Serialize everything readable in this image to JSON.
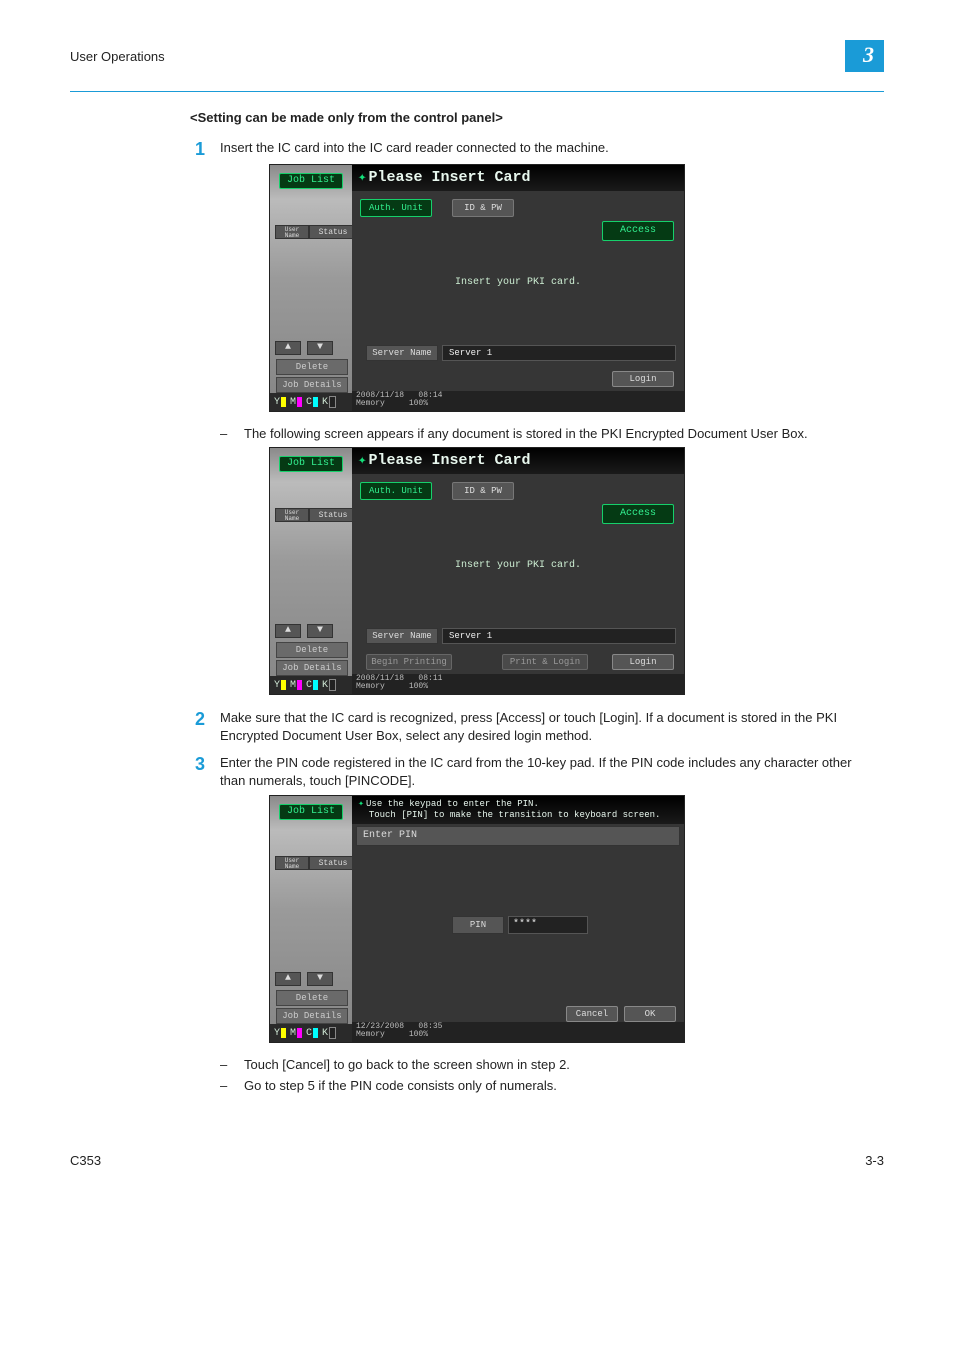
{
  "header": {
    "section": "User Operations",
    "chapter_number": "3"
  },
  "heading": "<Setting can be made only from the control panel>",
  "steps": {
    "s1": {
      "num": "1",
      "text": "Insert the IC card into the IC card reader connected to the machine."
    },
    "note1": "The following screen appears if any document is stored in the PKI Encrypted Document User Box.",
    "s2": {
      "num": "2",
      "text": "Make sure that the IC card is recognized, press [Access] or touch [Login]. If a document is stored in the PKI Encrypted Document User Box, select any desired login method."
    },
    "s3": {
      "num": "3",
      "text": "Enter the PIN code registered in the IC card from the 10-key pad. If the PIN code includes any character other than numerals, touch [PINCODE]."
    },
    "note3a": "Touch [Cancel] to go back to the screen shown in step 2.",
    "note3b": "Go to step 5 if the PIN code consists only of numerals."
  },
  "panel_common": {
    "job_list": "Job List",
    "user_name": "User Name",
    "status": "Status",
    "delete": "Delete",
    "job_details": "Job Details",
    "toners": [
      "Y",
      "M",
      "C",
      "K"
    ],
    "memory_label": "Memory",
    "memory_value": "100%"
  },
  "panel1": {
    "title": "Please Insert Card",
    "tab_auth": "Auth. Unit",
    "tab_idpw": "ID & PW",
    "access": "Access",
    "message": "Insert your PKI card.",
    "server_label": "Server Name",
    "server_value": "Server 1",
    "login": "Login",
    "date": "2008/11/18",
    "time": "08:14"
  },
  "panel2": {
    "title": "Please Insert Card",
    "tab_auth": "Auth. Unit",
    "tab_idpw": "ID & PW",
    "access": "Access",
    "message": "Insert your PKI card.",
    "server_label": "Server Name",
    "server_value": "Server 1",
    "begin_printing": "Begin Printing",
    "print_login": "Print & Login",
    "login": "Login",
    "date": "2008/11/18",
    "time": "08:11"
  },
  "panel3": {
    "title_line1": "Use the keypad to enter the PIN.",
    "title_line2": "Touch [PIN] to make the transition to keyboard screen.",
    "section": "Enter PIN",
    "pin_label": "PIN",
    "pin_value": "****",
    "cancel": "Cancel",
    "ok": "OK",
    "date": "12/23/2008",
    "time": "08:35"
  },
  "footer": {
    "model": "C353",
    "page": "3-3"
  }
}
